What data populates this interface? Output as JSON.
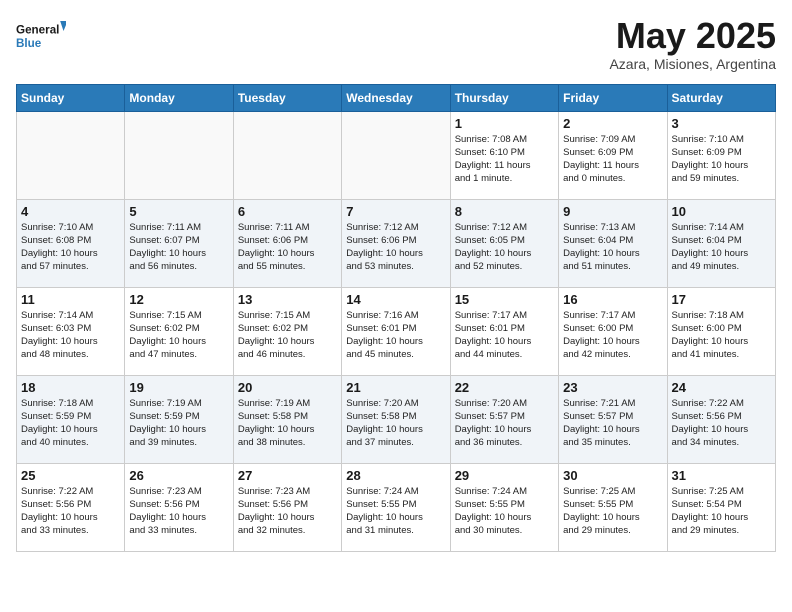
{
  "logo": {
    "line1": "General",
    "line2": "Blue"
  },
  "title": "May 2025",
  "subtitle": "Azara, Misiones, Argentina",
  "days_of_week": [
    "Sunday",
    "Monday",
    "Tuesday",
    "Wednesday",
    "Thursday",
    "Friday",
    "Saturday"
  ],
  "weeks": [
    [
      {
        "day": "",
        "info": ""
      },
      {
        "day": "",
        "info": ""
      },
      {
        "day": "",
        "info": ""
      },
      {
        "day": "",
        "info": ""
      },
      {
        "day": "1",
        "info": "Sunrise: 7:08 AM\nSunset: 6:10 PM\nDaylight: 11 hours\nand 1 minute."
      },
      {
        "day": "2",
        "info": "Sunrise: 7:09 AM\nSunset: 6:09 PM\nDaylight: 11 hours\nand 0 minutes."
      },
      {
        "day": "3",
        "info": "Sunrise: 7:10 AM\nSunset: 6:09 PM\nDaylight: 10 hours\nand 59 minutes."
      }
    ],
    [
      {
        "day": "4",
        "info": "Sunrise: 7:10 AM\nSunset: 6:08 PM\nDaylight: 10 hours\nand 57 minutes."
      },
      {
        "day": "5",
        "info": "Sunrise: 7:11 AM\nSunset: 6:07 PM\nDaylight: 10 hours\nand 56 minutes."
      },
      {
        "day": "6",
        "info": "Sunrise: 7:11 AM\nSunset: 6:06 PM\nDaylight: 10 hours\nand 55 minutes."
      },
      {
        "day": "7",
        "info": "Sunrise: 7:12 AM\nSunset: 6:06 PM\nDaylight: 10 hours\nand 53 minutes."
      },
      {
        "day": "8",
        "info": "Sunrise: 7:12 AM\nSunset: 6:05 PM\nDaylight: 10 hours\nand 52 minutes."
      },
      {
        "day": "9",
        "info": "Sunrise: 7:13 AM\nSunset: 6:04 PM\nDaylight: 10 hours\nand 51 minutes."
      },
      {
        "day": "10",
        "info": "Sunrise: 7:14 AM\nSunset: 6:04 PM\nDaylight: 10 hours\nand 49 minutes."
      }
    ],
    [
      {
        "day": "11",
        "info": "Sunrise: 7:14 AM\nSunset: 6:03 PM\nDaylight: 10 hours\nand 48 minutes."
      },
      {
        "day": "12",
        "info": "Sunrise: 7:15 AM\nSunset: 6:02 PM\nDaylight: 10 hours\nand 47 minutes."
      },
      {
        "day": "13",
        "info": "Sunrise: 7:15 AM\nSunset: 6:02 PM\nDaylight: 10 hours\nand 46 minutes."
      },
      {
        "day": "14",
        "info": "Sunrise: 7:16 AM\nSunset: 6:01 PM\nDaylight: 10 hours\nand 45 minutes."
      },
      {
        "day": "15",
        "info": "Sunrise: 7:17 AM\nSunset: 6:01 PM\nDaylight: 10 hours\nand 44 minutes."
      },
      {
        "day": "16",
        "info": "Sunrise: 7:17 AM\nSunset: 6:00 PM\nDaylight: 10 hours\nand 42 minutes."
      },
      {
        "day": "17",
        "info": "Sunrise: 7:18 AM\nSunset: 6:00 PM\nDaylight: 10 hours\nand 41 minutes."
      }
    ],
    [
      {
        "day": "18",
        "info": "Sunrise: 7:18 AM\nSunset: 5:59 PM\nDaylight: 10 hours\nand 40 minutes."
      },
      {
        "day": "19",
        "info": "Sunrise: 7:19 AM\nSunset: 5:59 PM\nDaylight: 10 hours\nand 39 minutes."
      },
      {
        "day": "20",
        "info": "Sunrise: 7:19 AM\nSunset: 5:58 PM\nDaylight: 10 hours\nand 38 minutes."
      },
      {
        "day": "21",
        "info": "Sunrise: 7:20 AM\nSunset: 5:58 PM\nDaylight: 10 hours\nand 37 minutes."
      },
      {
        "day": "22",
        "info": "Sunrise: 7:20 AM\nSunset: 5:57 PM\nDaylight: 10 hours\nand 36 minutes."
      },
      {
        "day": "23",
        "info": "Sunrise: 7:21 AM\nSunset: 5:57 PM\nDaylight: 10 hours\nand 35 minutes."
      },
      {
        "day": "24",
        "info": "Sunrise: 7:22 AM\nSunset: 5:56 PM\nDaylight: 10 hours\nand 34 minutes."
      }
    ],
    [
      {
        "day": "25",
        "info": "Sunrise: 7:22 AM\nSunset: 5:56 PM\nDaylight: 10 hours\nand 33 minutes."
      },
      {
        "day": "26",
        "info": "Sunrise: 7:23 AM\nSunset: 5:56 PM\nDaylight: 10 hours\nand 33 minutes."
      },
      {
        "day": "27",
        "info": "Sunrise: 7:23 AM\nSunset: 5:56 PM\nDaylight: 10 hours\nand 32 minutes."
      },
      {
        "day": "28",
        "info": "Sunrise: 7:24 AM\nSunset: 5:55 PM\nDaylight: 10 hours\nand 31 minutes."
      },
      {
        "day": "29",
        "info": "Sunrise: 7:24 AM\nSunset: 5:55 PM\nDaylight: 10 hours\nand 30 minutes."
      },
      {
        "day": "30",
        "info": "Sunrise: 7:25 AM\nSunset: 5:55 PM\nDaylight: 10 hours\nand 29 minutes."
      },
      {
        "day": "31",
        "info": "Sunrise: 7:25 AM\nSunset: 5:54 PM\nDaylight: 10 hours\nand 29 minutes."
      }
    ]
  ]
}
